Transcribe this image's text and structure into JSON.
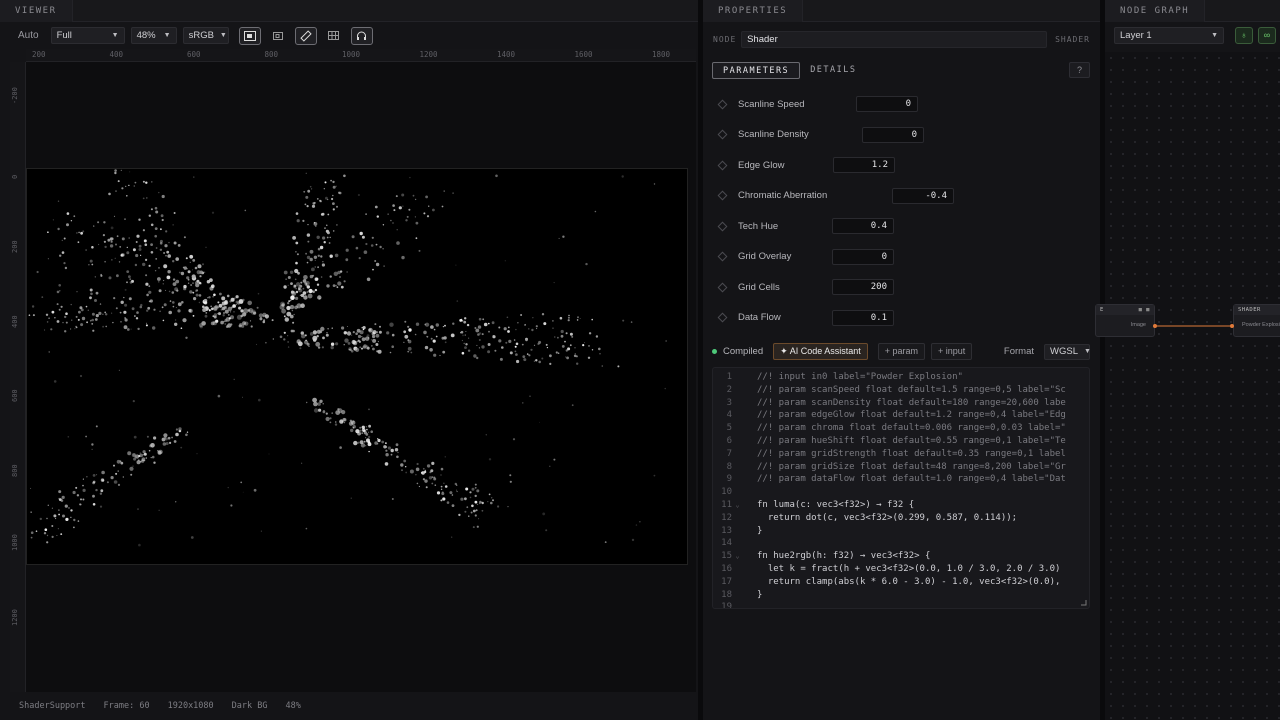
{
  "viewer": {
    "panel_title": "VIEWER",
    "auto_label": "Auto",
    "quality": "Full",
    "zoom": "48%",
    "colorspace": "sRGB",
    "ruler_x": [
      "200",
      "400",
      "600",
      "800",
      "1000",
      "1200",
      "1400",
      "1600",
      "1800"
    ],
    "ruler_y": [
      "-200",
      "0",
      "200",
      "400",
      "600",
      "800",
      "1000",
      "1200"
    ],
    "status": {
      "app": "ShaderSupport",
      "frame": "Frame: 60",
      "resolution": "1920x1080",
      "background": "Dark BG",
      "zoom": "48%"
    }
  },
  "properties": {
    "panel_title": "PROPERTIES",
    "node_label": "NODE",
    "node_name": "Shader",
    "node_type": "SHADER",
    "tabs": [
      {
        "label": "PARAMETERS",
        "active": true
      },
      {
        "label": "DETAILS",
        "active": false
      }
    ],
    "help_label": "?",
    "params": [
      {
        "name": "Scanline Speed",
        "value": "0"
      },
      {
        "name": "Scanline Density",
        "value": "0"
      },
      {
        "name": "Edge Glow",
        "value": "1.2"
      },
      {
        "name": "Chromatic Aberration",
        "value": "-0.4"
      },
      {
        "name": "Tech Hue",
        "value": "0.4"
      },
      {
        "name": "Grid Overlay",
        "value": "0"
      },
      {
        "name": "Grid Cells",
        "value": "200"
      },
      {
        "name": "Data Flow",
        "value": "0.1"
      }
    ],
    "code_bar": {
      "status": "Compiled",
      "ai_button": "AI Code Assistant",
      "add_param": "+ param",
      "add_input": "+ input",
      "format_label": "Format",
      "format_value": "WGSL"
    },
    "code_lines": [
      {
        "n": "1",
        "fold": "",
        "text": "//! input in0 label=\"Powder Explosion\""
      },
      {
        "n": "2",
        "fold": "",
        "text": "//! param scanSpeed float default=1.5 range=0,5 label=\"Sc"
      },
      {
        "n": "3",
        "fold": "",
        "text": "//! param scanDensity float default=180 range=20,600 labe"
      },
      {
        "n": "4",
        "fold": "",
        "text": "//! param edgeGlow float default=1.2 range=0,4 label=\"Edg"
      },
      {
        "n": "5",
        "fold": "",
        "text": "//! param chroma float default=0.006 range=0,0.03 label=\""
      },
      {
        "n": "6",
        "fold": "",
        "text": "//! param hueShift float default=0.55 range=0,1 label=\"Te"
      },
      {
        "n": "7",
        "fold": "",
        "text": "//! param gridStrength float default=0.35 range=0,1 label"
      },
      {
        "n": "8",
        "fold": "",
        "text": "//! param gridSize float default=48 range=8,200 label=\"Gr"
      },
      {
        "n": "9",
        "fold": "",
        "text": "//! param dataFlow float default=1.0 range=0,4 label=\"Dat"
      },
      {
        "n": "10",
        "fold": "",
        "text": ""
      },
      {
        "n": "11",
        "fold": "⌄",
        "text": "fn luma(c: vec3<f32>) → f32 {"
      },
      {
        "n": "12",
        "fold": "",
        "text": "  return dot(c, vec3<f32>(0.299, 0.587, 0.114));"
      },
      {
        "n": "13",
        "fold": "",
        "text": "}"
      },
      {
        "n": "14",
        "fold": "",
        "text": ""
      },
      {
        "n": "15",
        "fold": "⌄",
        "text": "fn hue2rgb(h: f32) → vec3<f32> {"
      },
      {
        "n": "16",
        "fold": "",
        "text": "  let k = fract(h + vec3<f32>(0.0, 1.0 / 3.0, 2.0 / 3.0)"
      },
      {
        "n": "17",
        "fold": "",
        "text": "  return clamp(abs(k * 6.0 - 3.0) - 1.0, vec3<f32>(0.0),"
      },
      {
        "n": "18",
        "fold": "",
        "text": "}"
      },
      {
        "n": "19",
        "fold": "",
        "text": ""
      }
    ]
  },
  "graph": {
    "panel_title": "NODE GRAPH",
    "layer": "Layer 1",
    "node_left": {
      "port": "Image"
    },
    "node_right": {
      "title": "SHADER",
      "port": "Powder Explosi"
    }
  },
  "colors": {
    "ai_accent": "#6b4a2b",
    "compiled_dot": "#4ec97a",
    "graph_link": "#e07a3a",
    "graph_icons": "#6fd06f"
  }
}
